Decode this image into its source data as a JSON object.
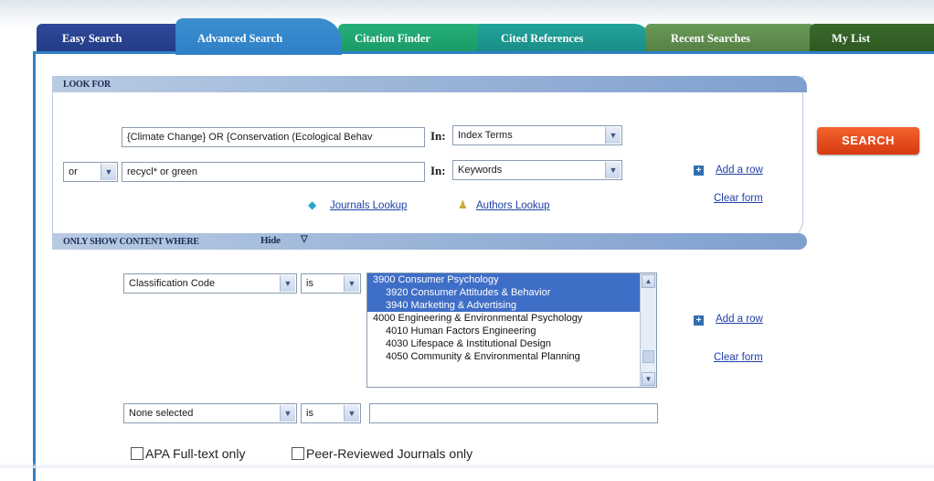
{
  "tabs": [
    {
      "label": "Easy Search"
    },
    {
      "label": "Advanced Search",
      "active": true
    },
    {
      "label": "Citation Finder"
    },
    {
      "label": "Cited References"
    },
    {
      "label": "Recent Searches"
    },
    {
      "label": "My List"
    }
  ],
  "look_for": {
    "section_label": "LOOK FOR",
    "rows": [
      {
        "term": "{Climate Change} OR {Conservation (Ecological Behav",
        "in_label": "In:",
        "field": "Index Terms"
      },
      {
        "operator": "or",
        "term": "recycl* or green",
        "in_label": "In:",
        "field": "Keywords"
      }
    ],
    "journals_lookup": "Journals Lookup",
    "authors_lookup": "Authors Lookup",
    "add_row": "Add a row",
    "clear_form": "Clear form"
  },
  "search_button": "SEARCH",
  "content_filter": {
    "section_label": "ONLY SHOW CONTENT WHERE",
    "hide_label": "Hide",
    "rows": [
      {
        "field": "Classification Code",
        "op": "is"
      },
      {
        "field": "None selected",
        "op": "is",
        "value": ""
      }
    ],
    "listbox_options": [
      {
        "label": "3900 Consumer Psychology",
        "selected": true
      },
      {
        "label": "3920 Consumer Attitudes & Behavior",
        "selected": true
      },
      {
        "label": "3940 Marketing & Advertising",
        "selected": true
      },
      {
        "label": "4000 Engineering & Environmental Psychology",
        "selected": false
      },
      {
        "label": "4010 Human Factors Engineering",
        "selected": false
      },
      {
        "label": "4030 Lifespace & Institutional Design",
        "selected": false
      },
      {
        "label": "4050 Community & Environmental Planning",
        "selected": false
      }
    ],
    "add_row": "Add a row",
    "clear_form": "Clear form"
  },
  "options": {
    "apa_fulltext": "APA Full-text only",
    "peer_reviewed": "Peer-Reviewed Journals only"
  },
  "colors": {
    "active_tab": "#2f80c6",
    "search_button": "#e24a1c",
    "selection": "#3f6ec6",
    "link": "#1f3fa8"
  }
}
